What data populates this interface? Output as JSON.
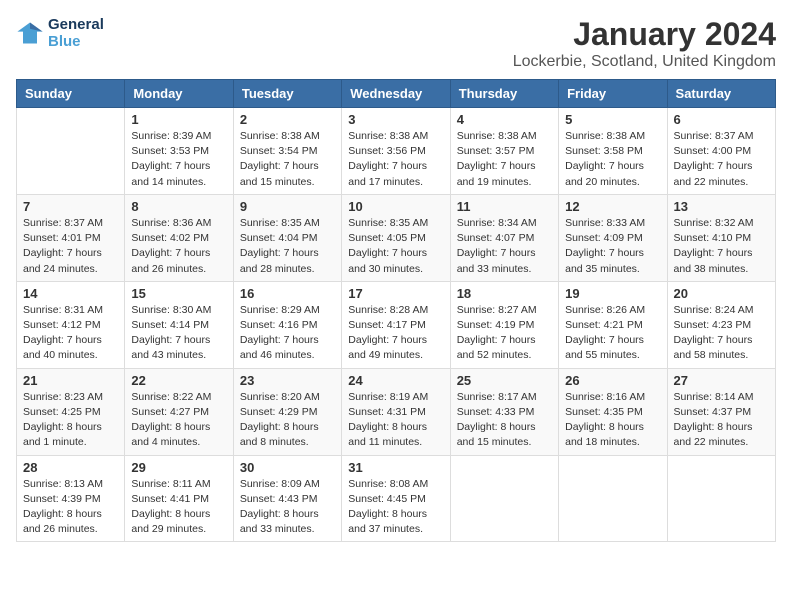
{
  "header": {
    "logo_line1": "General",
    "logo_line2": "Blue",
    "title": "January 2024",
    "subtitle": "Lockerbie, Scotland, United Kingdom"
  },
  "weekdays": [
    "Sunday",
    "Monday",
    "Tuesday",
    "Wednesday",
    "Thursday",
    "Friday",
    "Saturday"
  ],
  "weeks": [
    [
      {
        "day": "",
        "sunrise": "",
        "sunset": "",
        "daylight": ""
      },
      {
        "day": "1",
        "sunrise": "Sunrise: 8:39 AM",
        "sunset": "Sunset: 3:53 PM",
        "daylight": "Daylight: 7 hours and 14 minutes."
      },
      {
        "day": "2",
        "sunrise": "Sunrise: 8:38 AM",
        "sunset": "Sunset: 3:54 PM",
        "daylight": "Daylight: 7 hours and 15 minutes."
      },
      {
        "day": "3",
        "sunrise": "Sunrise: 8:38 AM",
        "sunset": "Sunset: 3:56 PM",
        "daylight": "Daylight: 7 hours and 17 minutes."
      },
      {
        "day": "4",
        "sunrise": "Sunrise: 8:38 AM",
        "sunset": "Sunset: 3:57 PM",
        "daylight": "Daylight: 7 hours and 19 minutes."
      },
      {
        "day": "5",
        "sunrise": "Sunrise: 8:38 AM",
        "sunset": "Sunset: 3:58 PM",
        "daylight": "Daylight: 7 hours and 20 minutes."
      },
      {
        "day": "6",
        "sunrise": "Sunrise: 8:37 AM",
        "sunset": "Sunset: 4:00 PM",
        "daylight": "Daylight: 7 hours and 22 minutes."
      }
    ],
    [
      {
        "day": "7",
        "sunrise": "Sunrise: 8:37 AM",
        "sunset": "Sunset: 4:01 PM",
        "daylight": "Daylight: 7 hours and 24 minutes."
      },
      {
        "day": "8",
        "sunrise": "Sunrise: 8:36 AM",
        "sunset": "Sunset: 4:02 PM",
        "daylight": "Daylight: 7 hours and 26 minutes."
      },
      {
        "day": "9",
        "sunrise": "Sunrise: 8:35 AM",
        "sunset": "Sunset: 4:04 PM",
        "daylight": "Daylight: 7 hours and 28 minutes."
      },
      {
        "day": "10",
        "sunrise": "Sunrise: 8:35 AM",
        "sunset": "Sunset: 4:05 PM",
        "daylight": "Daylight: 7 hours and 30 minutes."
      },
      {
        "day": "11",
        "sunrise": "Sunrise: 8:34 AM",
        "sunset": "Sunset: 4:07 PM",
        "daylight": "Daylight: 7 hours and 33 minutes."
      },
      {
        "day": "12",
        "sunrise": "Sunrise: 8:33 AM",
        "sunset": "Sunset: 4:09 PM",
        "daylight": "Daylight: 7 hours and 35 minutes."
      },
      {
        "day": "13",
        "sunrise": "Sunrise: 8:32 AM",
        "sunset": "Sunset: 4:10 PM",
        "daylight": "Daylight: 7 hours and 38 minutes."
      }
    ],
    [
      {
        "day": "14",
        "sunrise": "Sunrise: 8:31 AM",
        "sunset": "Sunset: 4:12 PM",
        "daylight": "Daylight: 7 hours and 40 minutes."
      },
      {
        "day": "15",
        "sunrise": "Sunrise: 8:30 AM",
        "sunset": "Sunset: 4:14 PM",
        "daylight": "Daylight: 7 hours and 43 minutes."
      },
      {
        "day": "16",
        "sunrise": "Sunrise: 8:29 AM",
        "sunset": "Sunset: 4:16 PM",
        "daylight": "Daylight: 7 hours and 46 minutes."
      },
      {
        "day": "17",
        "sunrise": "Sunrise: 8:28 AM",
        "sunset": "Sunset: 4:17 PM",
        "daylight": "Daylight: 7 hours and 49 minutes."
      },
      {
        "day": "18",
        "sunrise": "Sunrise: 8:27 AM",
        "sunset": "Sunset: 4:19 PM",
        "daylight": "Daylight: 7 hours and 52 minutes."
      },
      {
        "day": "19",
        "sunrise": "Sunrise: 8:26 AM",
        "sunset": "Sunset: 4:21 PM",
        "daylight": "Daylight: 7 hours and 55 minutes."
      },
      {
        "day": "20",
        "sunrise": "Sunrise: 8:24 AM",
        "sunset": "Sunset: 4:23 PM",
        "daylight": "Daylight: 7 hours and 58 minutes."
      }
    ],
    [
      {
        "day": "21",
        "sunrise": "Sunrise: 8:23 AM",
        "sunset": "Sunset: 4:25 PM",
        "daylight": "Daylight: 8 hours and 1 minute."
      },
      {
        "day": "22",
        "sunrise": "Sunrise: 8:22 AM",
        "sunset": "Sunset: 4:27 PM",
        "daylight": "Daylight: 8 hours and 4 minutes."
      },
      {
        "day": "23",
        "sunrise": "Sunrise: 8:20 AM",
        "sunset": "Sunset: 4:29 PM",
        "daylight": "Daylight: 8 hours and 8 minutes."
      },
      {
        "day": "24",
        "sunrise": "Sunrise: 8:19 AM",
        "sunset": "Sunset: 4:31 PM",
        "daylight": "Daylight: 8 hours and 11 minutes."
      },
      {
        "day": "25",
        "sunrise": "Sunrise: 8:17 AM",
        "sunset": "Sunset: 4:33 PM",
        "daylight": "Daylight: 8 hours and 15 minutes."
      },
      {
        "day": "26",
        "sunrise": "Sunrise: 8:16 AM",
        "sunset": "Sunset: 4:35 PM",
        "daylight": "Daylight: 8 hours and 18 minutes."
      },
      {
        "day": "27",
        "sunrise": "Sunrise: 8:14 AM",
        "sunset": "Sunset: 4:37 PM",
        "daylight": "Daylight: 8 hours and 22 minutes."
      }
    ],
    [
      {
        "day": "28",
        "sunrise": "Sunrise: 8:13 AM",
        "sunset": "Sunset: 4:39 PM",
        "daylight": "Daylight: 8 hours and 26 minutes."
      },
      {
        "day": "29",
        "sunrise": "Sunrise: 8:11 AM",
        "sunset": "Sunset: 4:41 PM",
        "daylight": "Daylight: 8 hours and 29 minutes."
      },
      {
        "day": "30",
        "sunrise": "Sunrise: 8:09 AM",
        "sunset": "Sunset: 4:43 PM",
        "daylight": "Daylight: 8 hours and 33 minutes."
      },
      {
        "day": "31",
        "sunrise": "Sunrise: 8:08 AM",
        "sunset": "Sunset: 4:45 PM",
        "daylight": "Daylight: 8 hours and 37 minutes."
      },
      {
        "day": "",
        "sunrise": "",
        "sunset": "",
        "daylight": ""
      },
      {
        "day": "",
        "sunrise": "",
        "sunset": "",
        "daylight": ""
      },
      {
        "day": "",
        "sunrise": "",
        "sunset": "",
        "daylight": ""
      }
    ]
  ]
}
